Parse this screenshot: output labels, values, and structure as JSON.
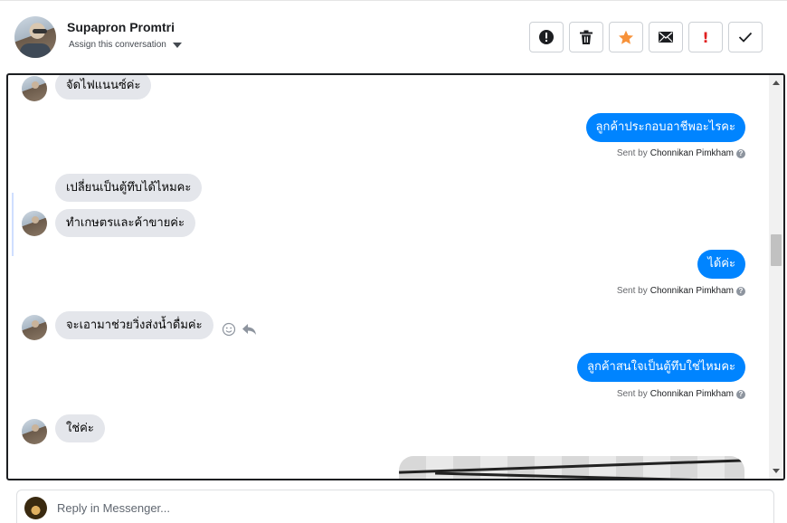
{
  "header": {
    "contact_name": "Supapron Promtri",
    "assign_label": "Assign this conversation"
  },
  "actions": [
    {
      "name": "spam-button",
      "icon": "alert-circle-icon"
    },
    {
      "name": "delete-button",
      "icon": "trash-icon"
    },
    {
      "name": "star-button",
      "icon": "star-icon",
      "color": "#f7923a"
    },
    {
      "name": "mark-unread-button",
      "icon": "envelope-icon"
    },
    {
      "name": "follow-up-button",
      "icon": "exclamation-icon",
      "label": "!",
      "color": "#e02020"
    },
    {
      "name": "mark-done-button",
      "icon": "checkmark-icon"
    }
  ],
  "messages": [
    {
      "dir": "in",
      "text": "จัดไฟแนนซ์ค่ะ"
    },
    {
      "dir": "out",
      "text": "ลูกค้าประกอบอาชีพอะไรคะ",
      "sent_by_prefix": "Sent by",
      "sent_by": "Chonnikan Pimkham"
    },
    {
      "dir": "in",
      "text": "เปลี่ยนเป็นตู้ทึบได้ไหมคะ"
    },
    {
      "dir": "in",
      "text": "ทำเกษตรและค้าขายค่ะ"
    },
    {
      "dir": "out",
      "text": "ได้ค่ะ",
      "sent_by_prefix": "Sent by",
      "sent_by": "Chonnikan Pimkham"
    },
    {
      "dir": "in",
      "text": "จะเอามาช่วยวิ่งส่งน้ำดื่มค่ะ"
    },
    {
      "dir": "out",
      "text": "ลูกค้าสนใจเป็นตู้ทึบใช่ไหมคะ",
      "sent_by_prefix": "Sent by",
      "sent_by": "Chonnikan Pimkham"
    },
    {
      "dir": "in",
      "text": "ใช่ค่ะ"
    }
  ],
  "reply": {
    "placeholder": "Reply in Messenger..."
  },
  "colors": {
    "outgoing_bubble": "#0084ff",
    "incoming_bubble": "#e4e6eb"
  }
}
